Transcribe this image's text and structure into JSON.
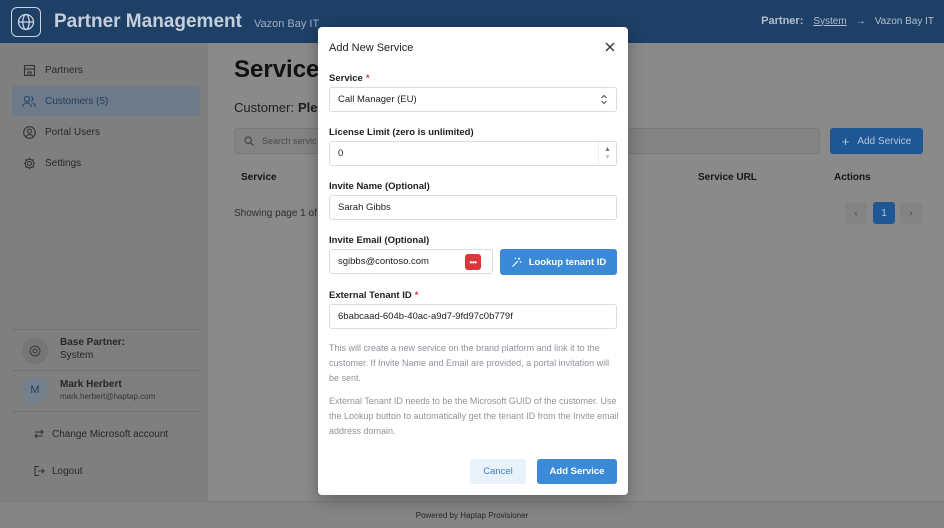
{
  "header": {
    "title": "Partner Management",
    "subtitle": "Vazon Bay IT",
    "partner_label": "Partner:",
    "partner_link": "System",
    "partner_separator": "→",
    "partner_current": "Vazon Bay IT",
    "logo_icon": "globe-icon",
    "background": "#1e3f66"
  },
  "sidebar": {
    "items": [
      {
        "label": "Partners",
        "icon": "building-icon",
        "active": false
      },
      {
        "label": "Customers (5)",
        "icon": "users-icon",
        "active": true
      },
      {
        "label": "Portal Users",
        "icon": "user-circle-icon",
        "active": false
      },
      {
        "label": "Settings",
        "icon": "gear-icon",
        "active": false
      }
    ],
    "base_partner_label": "Base Partner:",
    "base_partner_value": "System",
    "user_initial": "M",
    "user_name": "Mark Herbert",
    "user_email": "mark.herbert@haptap.com",
    "change_account": "Change Microsoft account",
    "logout": "Logout"
  },
  "main": {
    "title": "Service",
    "customer_label": "Customer:",
    "customer_value": "Ple",
    "search_placeholder": "Search servic",
    "add_service": "Add Service",
    "columns": {
      "service": "Service",
      "service_url": "Service URL",
      "actions": "Actions"
    },
    "showing": "Showing page 1 of",
    "pagination": {
      "prev": "‹",
      "current": "1",
      "next": "›"
    }
  },
  "modal": {
    "title": "Add New Service",
    "service_label": "Service",
    "service_required": "*",
    "service_value": "Call Manager (EU)",
    "license_label": "License Limit (zero is unlimited)",
    "license_value": "0",
    "invite_name_label": "Invite Name (Optional)",
    "invite_name_value": "Sarah Gibbs",
    "invite_email_label": "Invite Email (Optional)",
    "invite_email_value": "sgibbs@contoso.com",
    "password_manager_badge": "•••",
    "lookup_button": "Lookup tenant ID",
    "tenant_label": "External Tenant ID",
    "tenant_required": "*",
    "tenant_value": "6babcaad-604b-40ac-a9d7-9fd97c0b779f",
    "help_1": "This will create a new service on the brand platform and link it to the customer. If Invite Name and Email are provided, a portal invitation will be sent.",
    "help_2": "External Tenant ID needs to be the Microsoft GUID of the customer. Use the Lookup button to automatically get the tenant ID from the Invite email address domain.",
    "cancel_button": "Cancel",
    "submit_button": "Add Service",
    "accent": "#3b8ad7"
  },
  "footer": {
    "text": "Powered by Haptap Provisioner"
  }
}
